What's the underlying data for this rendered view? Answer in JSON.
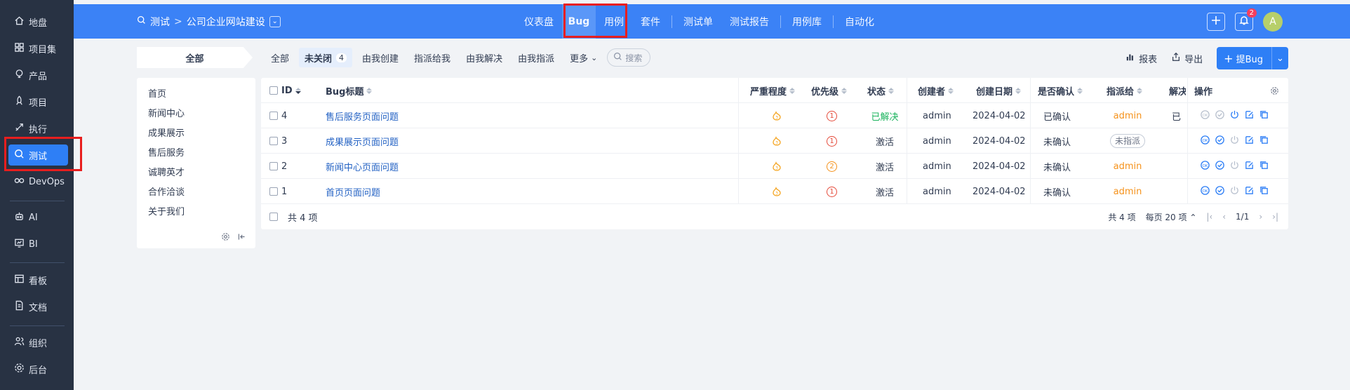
{
  "sidebar": {
    "items": [
      {
        "label": "地盘",
        "icon": "home-icon"
      },
      {
        "label": "项目集",
        "icon": "grid-icon"
      },
      {
        "label": "产品",
        "icon": "lightbulb-icon"
      },
      {
        "label": "项目",
        "icon": "rocket-icon"
      },
      {
        "label": "执行",
        "icon": "run-icon"
      },
      {
        "label": "测试",
        "icon": "test-search-icon",
        "active": true
      },
      {
        "label": "DevOps",
        "icon": "infinity-icon"
      },
      {
        "label": "AI",
        "icon": "robot-icon"
      },
      {
        "label": "BI",
        "icon": "chart-board-icon"
      },
      {
        "label": "看板",
        "icon": "kanban-icon"
      },
      {
        "label": "文档",
        "icon": "doc-icon"
      },
      {
        "label": "组织",
        "icon": "people-icon"
      },
      {
        "label": "后台",
        "icon": "settings-icon"
      }
    ]
  },
  "topbar": {
    "breadcrumb_root": "测试",
    "breadcrumb_separator": ">",
    "breadcrumb_product": "公司企业网站建设",
    "nav": [
      "仪表盘",
      "Bug",
      "用例",
      "套件",
      "测试单",
      "测试报告",
      "用例库",
      "自动化"
    ],
    "active_nav": "Bug",
    "notification_count": "2",
    "avatar_letter": "A"
  },
  "filters": {
    "all_tab": "全部",
    "items": [
      {
        "label": "全部"
      },
      {
        "label": "未关闭",
        "count": "4",
        "active": true
      },
      {
        "label": "由我创建"
      },
      {
        "label": "指派给我"
      },
      {
        "label": "由我解决"
      },
      {
        "label": "由我指派"
      },
      {
        "label": "更多"
      }
    ],
    "search_placeholder": "搜索",
    "report": "报表",
    "export": "导出",
    "new_bug": "提Bug"
  },
  "modules": [
    "首页",
    "新闻中心",
    "成果展示",
    "售后服务",
    "诚聘英才",
    "合作洽谈",
    "关于我们"
  ],
  "table": {
    "headers": {
      "id": "ID",
      "title": "Bug标题",
      "severity": "严重程度",
      "priority": "优先级",
      "status": "状态",
      "creator": "创建者",
      "created": "创建日期",
      "confirmed": "是否确认",
      "assigned": "指派给",
      "resolution": "解决",
      "ops": "操作"
    },
    "rows": [
      {
        "id": "4",
        "title": "售后服务页面问题",
        "severity": "3",
        "priority": "1",
        "status": "已解决",
        "creator": "admin",
        "created": "2024-04-02",
        "confirmed": "已确认",
        "assigned": "admin",
        "resolution": "已"
      },
      {
        "id": "3",
        "title": "成果展示页面问题",
        "severity": "3",
        "priority": "1",
        "status": "激活",
        "creator": "admin",
        "created": "2024-04-02",
        "confirmed": "未确认",
        "assigned": "未指派",
        "resolution": ""
      },
      {
        "id": "2",
        "title": "新闻中心页面问题",
        "severity": "3",
        "priority": "2",
        "status": "激活",
        "creator": "admin",
        "created": "2024-04-02",
        "confirmed": "未确认",
        "assigned": "admin",
        "resolution": ""
      },
      {
        "id": "1",
        "title": "首页页面问题",
        "severity": "3",
        "priority": "1",
        "status": "激活",
        "creator": "admin",
        "created": "2024-04-02",
        "confirmed": "未确认",
        "assigned": "admin",
        "resolution": ""
      }
    ],
    "footer_count": "共 4 项",
    "pager_total": "共 4 项",
    "pager_per_page": "每页 20 项",
    "pager_pages": "1/1"
  }
}
